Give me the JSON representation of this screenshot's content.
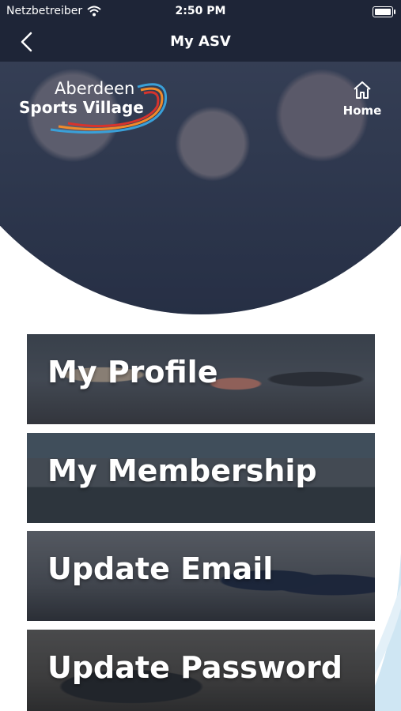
{
  "status_bar": {
    "carrier": "Netzbetreiber",
    "time": "2:50 PM"
  },
  "nav": {
    "title": "My ASV",
    "back_icon": "chevron-left-icon"
  },
  "hero": {
    "logo_line1": "Aberdeen",
    "logo_line2": "Sports Village",
    "home_label": "Home",
    "home_icon": "home-icon"
  },
  "menu": {
    "items": [
      {
        "label": "My Profile"
      },
      {
        "label": "My Membership"
      },
      {
        "label": "Update Email"
      },
      {
        "label": "Update Password"
      }
    ]
  },
  "colors": {
    "header_bg": "#1e2537",
    "accent_blue": "#3aa0d8",
    "accent_orange": "#f18a2a",
    "accent_red": "#d8332d",
    "wave_light_blue": "#cfe6f3"
  }
}
